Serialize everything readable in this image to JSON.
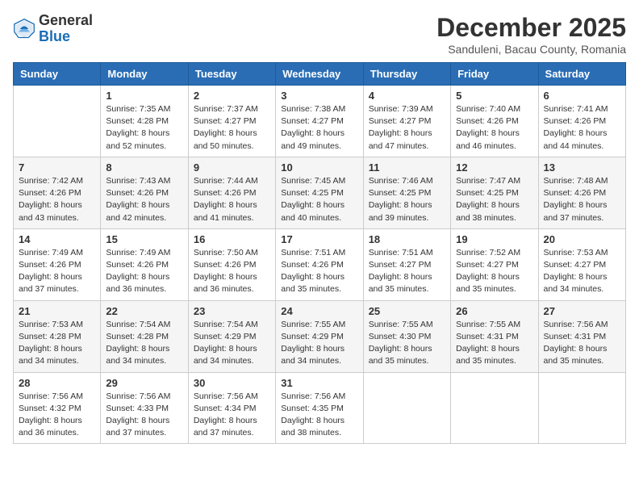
{
  "header": {
    "logo_general": "General",
    "logo_blue": "Blue",
    "month_title": "December 2025",
    "subtitle": "Sanduleni, Bacau County, Romania"
  },
  "weekdays": [
    "Sunday",
    "Monday",
    "Tuesday",
    "Wednesday",
    "Thursday",
    "Friday",
    "Saturday"
  ],
  "weeks": [
    [
      {
        "day": "",
        "info": ""
      },
      {
        "day": "1",
        "info": "Sunrise: 7:35 AM\nSunset: 4:28 PM\nDaylight: 8 hours\nand 52 minutes."
      },
      {
        "day": "2",
        "info": "Sunrise: 7:37 AM\nSunset: 4:27 PM\nDaylight: 8 hours\nand 50 minutes."
      },
      {
        "day": "3",
        "info": "Sunrise: 7:38 AM\nSunset: 4:27 PM\nDaylight: 8 hours\nand 49 minutes."
      },
      {
        "day": "4",
        "info": "Sunrise: 7:39 AM\nSunset: 4:27 PM\nDaylight: 8 hours\nand 47 minutes."
      },
      {
        "day": "5",
        "info": "Sunrise: 7:40 AM\nSunset: 4:26 PM\nDaylight: 8 hours\nand 46 minutes."
      },
      {
        "day": "6",
        "info": "Sunrise: 7:41 AM\nSunset: 4:26 PM\nDaylight: 8 hours\nand 44 minutes."
      }
    ],
    [
      {
        "day": "7",
        "info": "Sunrise: 7:42 AM\nSunset: 4:26 PM\nDaylight: 8 hours\nand 43 minutes."
      },
      {
        "day": "8",
        "info": "Sunrise: 7:43 AM\nSunset: 4:26 PM\nDaylight: 8 hours\nand 42 minutes."
      },
      {
        "day": "9",
        "info": "Sunrise: 7:44 AM\nSunset: 4:26 PM\nDaylight: 8 hours\nand 41 minutes."
      },
      {
        "day": "10",
        "info": "Sunrise: 7:45 AM\nSunset: 4:25 PM\nDaylight: 8 hours\nand 40 minutes."
      },
      {
        "day": "11",
        "info": "Sunrise: 7:46 AM\nSunset: 4:25 PM\nDaylight: 8 hours\nand 39 minutes."
      },
      {
        "day": "12",
        "info": "Sunrise: 7:47 AM\nSunset: 4:25 PM\nDaylight: 8 hours\nand 38 minutes."
      },
      {
        "day": "13",
        "info": "Sunrise: 7:48 AM\nSunset: 4:26 PM\nDaylight: 8 hours\nand 37 minutes."
      }
    ],
    [
      {
        "day": "14",
        "info": "Sunrise: 7:49 AM\nSunset: 4:26 PM\nDaylight: 8 hours\nand 37 minutes."
      },
      {
        "day": "15",
        "info": "Sunrise: 7:49 AM\nSunset: 4:26 PM\nDaylight: 8 hours\nand 36 minutes."
      },
      {
        "day": "16",
        "info": "Sunrise: 7:50 AM\nSunset: 4:26 PM\nDaylight: 8 hours\nand 36 minutes."
      },
      {
        "day": "17",
        "info": "Sunrise: 7:51 AM\nSunset: 4:26 PM\nDaylight: 8 hours\nand 35 minutes."
      },
      {
        "day": "18",
        "info": "Sunrise: 7:51 AM\nSunset: 4:27 PM\nDaylight: 8 hours\nand 35 minutes."
      },
      {
        "day": "19",
        "info": "Sunrise: 7:52 AM\nSunset: 4:27 PM\nDaylight: 8 hours\nand 35 minutes."
      },
      {
        "day": "20",
        "info": "Sunrise: 7:53 AM\nSunset: 4:27 PM\nDaylight: 8 hours\nand 34 minutes."
      }
    ],
    [
      {
        "day": "21",
        "info": "Sunrise: 7:53 AM\nSunset: 4:28 PM\nDaylight: 8 hours\nand 34 minutes."
      },
      {
        "day": "22",
        "info": "Sunrise: 7:54 AM\nSunset: 4:28 PM\nDaylight: 8 hours\nand 34 minutes."
      },
      {
        "day": "23",
        "info": "Sunrise: 7:54 AM\nSunset: 4:29 PM\nDaylight: 8 hours\nand 34 minutes."
      },
      {
        "day": "24",
        "info": "Sunrise: 7:55 AM\nSunset: 4:29 PM\nDaylight: 8 hours\nand 34 minutes."
      },
      {
        "day": "25",
        "info": "Sunrise: 7:55 AM\nSunset: 4:30 PM\nDaylight: 8 hours\nand 35 minutes."
      },
      {
        "day": "26",
        "info": "Sunrise: 7:55 AM\nSunset: 4:31 PM\nDaylight: 8 hours\nand 35 minutes."
      },
      {
        "day": "27",
        "info": "Sunrise: 7:56 AM\nSunset: 4:31 PM\nDaylight: 8 hours\nand 35 minutes."
      }
    ],
    [
      {
        "day": "28",
        "info": "Sunrise: 7:56 AM\nSunset: 4:32 PM\nDaylight: 8 hours\nand 36 minutes."
      },
      {
        "day": "29",
        "info": "Sunrise: 7:56 AM\nSunset: 4:33 PM\nDaylight: 8 hours\nand 37 minutes."
      },
      {
        "day": "30",
        "info": "Sunrise: 7:56 AM\nSunset: 4:34 PM\nDaylight: 8 hours\nand 37 minutes."
      },
      {
        "day": "31",
        "info": "Sunrise: 7:56 AM\nSunset: 4:35 PM\nDaylight: 8 hours\nand 38 minutes."
      },
      {
        "day": "",
        "info": ""
      },
      {
        "day": "",
        "info": ""
      },
      {
        "day": "",
        "info": ""
      }
    ]
  ]
}
